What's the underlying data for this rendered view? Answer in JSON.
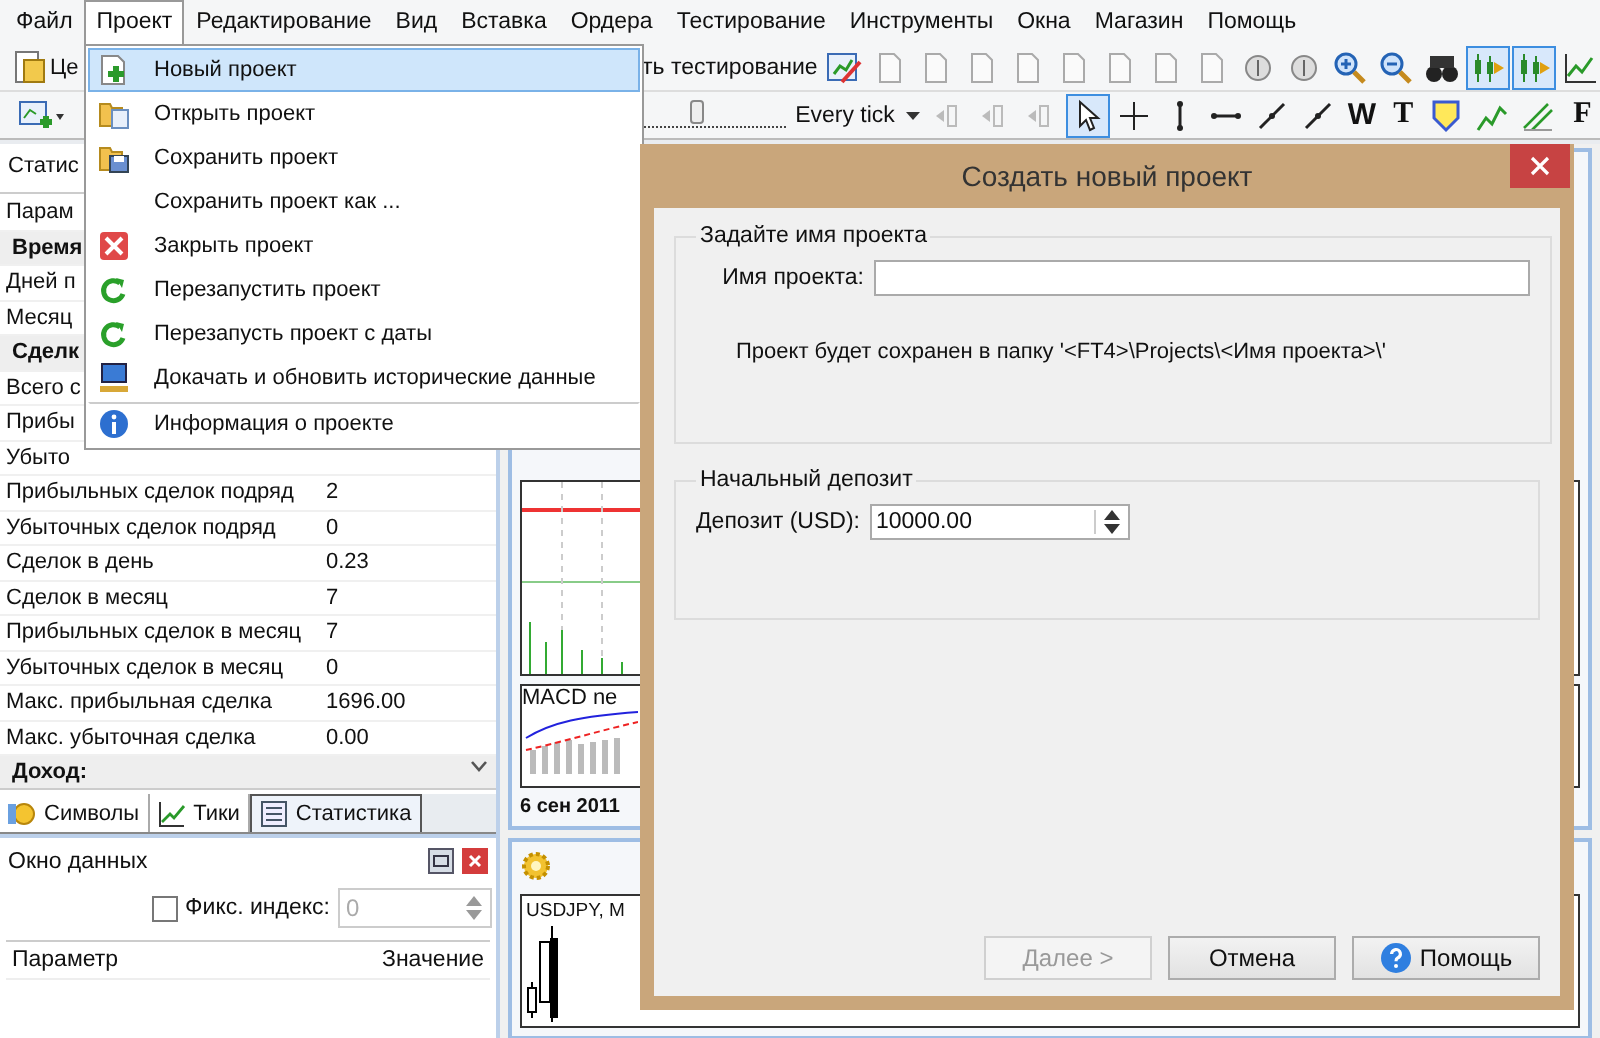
{
  "menubar": {
    "items": [
      {
        "label": "Файл",
        "selected": false
      },
      {
        "label": "Проект",
        "selected": true
      },
      {
        "label": "Редактирование",
        "selected": false
      },
      {
        "label": "Вид",
        "selected": false
      },
      {
        "label": "Вставка",
        "selected": false
      },
      {
        "label": "Ордера",
        "selected": false
      },
      {
        "label": "Тестирование",
        "selected": false
      },
      {
        "label": "Инструменты",
        "selected": false
      },
      {
        "label": "Окна",
        "selected": false
      },
      {
        "label": "Магазин",
        "selected": false
      },
      {
        "label": "Помощь",
        "selected": false
      }
    ]
  },
  "toolbar": {
    "start_label": "Це",
    "run_testing_label": "ть тестирование",
    "speed_slider": {
      "level": 0.4
    },
    "tick_mode": "Every tick",
    "tool_glyphs": [
      "W",
      "T",
      "F"
    ]
  },
  "project_menu": {
    "items": [
      {
        "label": "Новый проект",
        "highlighted": true,
        "separator_before": false
      },
      {
        "label": "Открыть проект",
        "highlighted": false,
        "separator_before": false
      },
      {
        "label": "Сохранить проект",
        "highlighted": false,
        "separator_before": false
      },
      {
        "label": "Сохранить проект как ...",
        "highlighted": false,
        "separator_before": false
      },
      {
        "label": "Закрыть проект",
        "highlighted": false,
        "separator_before": false
      },
      {
        "label": "Перезапустить проект",
        "highlighted": false,
        "separator_before": false
      },
      {
        "label": "Перезапусть проект с даты",
        "highlighted": false,
        "separator_before": false
      },
      {
        "label": "Докачать и обновить исторические данные",
        "highlighted": false,
        "separator_before": false
      },
      {
        "label": "Информация о проекте",
        "highlighted": false,
        "separator_before": true
      }
    ]
  },
  "stats_panel": {
    "title": "Статис",
    "column": "Парам",
    "rows": [
      {
        "kind": "section",
        "label": "Время"
      },
      {
        "kind": "row",
        "label": "Дней п"
      },
      {
        "kind": "row",
        "label": "Месяц"
      },
      {
        "kind": "section",
        "label": "Сделк"
      },
      {
        "kind": "row",
        "label": "Всего с"
      },
      {
        "kind": "row",
        "label": "Прибы"
      },
      {
        "kind": "row",
        "label": "Убыто"
      },
      {
        "kind": "row",
        "label": "Прибыльных сделок подряд",
        "value": "2"
      },
      {
        "kind": "row",
        "label": "Убыточных сделок подряд",
        "value": "0"
      },
      {
        "kind": "row",
        "label": "Сделок в день",
        "value": "0.23"
      },
      {
        "kind": "row",
        "label": "Сделок в месяц",
        "value": "7"
      },
      {
        "kind": "row",
        "label": "Прибыльных сделок в месяц",
        "value": "7"
      },
      {
        "kind": "row",
        "label": "Убыточных сделок в месяц",
        "value": "0"
      },
      {
        "kind": "row",
        "label": "Макс. прибыльная сделка",
        "value": "1696.00"
      },
      {
        "kind": "row",
        "label": "Макс. убыточная сделка",
        "value": "0.00"
      },
      {
        "kind": "section",
        "label": "Доход:"
      }
    ]
  },
  "bottom_tabs": [
    {
      "label": "Символы",
      "selected": false
    },
    {
      "label": "Тики",
      "selected": false
    },
    {
      "label": "Статистика",
      "selected": true
    }
  ],
  "data_window": {
    "title": "Окно данных",
    "fixed_index": {
      "label": "Фикс. индекс:",
      "checked": false,
      "value": "0",
      "disabled": true
    },
    "columns": [
      "Параметр",
      "Значение"
    ]
  },
  "charts": [
    {
      "indicator_label": "MACD ne",
      "date_label": "6 сен 2011"
    },
    {
      "title": "USDJPY, M"
    }
  ],
  "dialog": {
    "title": "Создать новый проект",
    "name_group": {
      "legend": "Задайте имя проекта",
      "label": "Имя проекта:",
      "hint": "Проект будет сохранен в папку '<FT4>\\Projects\\<Имя проекта>\\'"
    },
    "deposit_group": {
      "legend": "Начальный депозит",
      "label": "Депозит (USD):",
      "value": "10000.00"
    },
    "buttons": [
      {
        "label": "Далее >",
        "disabled": true,
        "kind": "plain"
      },
      {
        "label": "Отмена",
        "disabled": false,
        "kind": "plain"
      },
      {
        "label": "Помощь",
        "disabled": false,
        "kind": "help"
      }
    ]
  }
}
